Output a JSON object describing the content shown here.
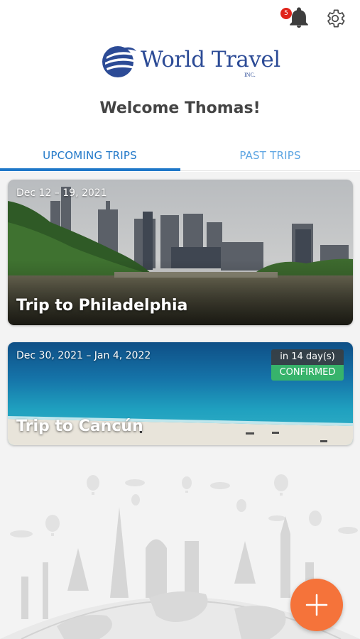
{
  "header": {
    "notifications_count": "5"
  },
  "logo": {
    "name": "World Travel",
    "suffix": "INC."
  },
  "welcome": "Welcome Thomas!",
  "tabs": [
    {
      "label": "UPCOMING TRIPS",
      "active": true
    },
    {
      "label": "PAST TRIPS",
      "active": false
    }
  ],
  "trips": [
    {
      "dates": "Dec 12 – 19, 2021",
      "title": "Trip to Philadelphia"
    },
    {
      "dates": "Dec 30, 2021 – Jan 4, 2022",
      "title": "Trip to Cancún",
      "countdown": "in 14 day(s)",
      "status": "CONFIRMED"
    }
  ],
  "colors": {
    "brand": "#2c4b96",
    "accent": "#1f77c8",
    "confirmed": "#37b36b",
    "fab": "#f5733a",
    "badge": "#e0241b"
  },
  "icons": {
    "notifications": "bell-icon",
    "settings": "gear-icon",
    "add": "plus-icon"
  }
}
